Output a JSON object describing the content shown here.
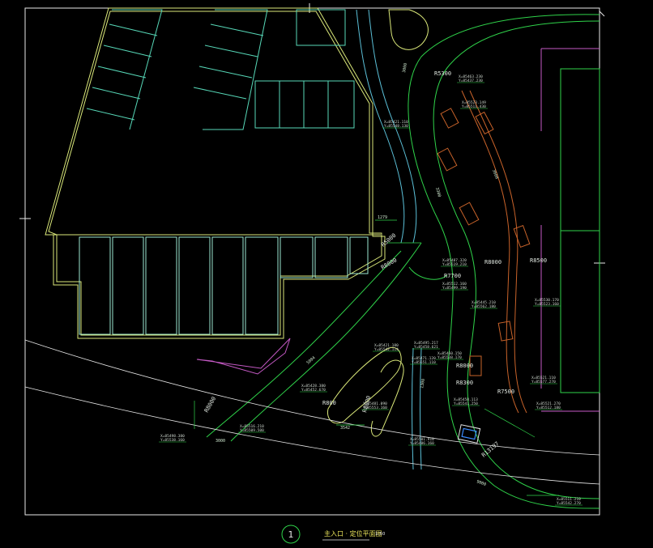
{
  "drawing": {
    "sheet_number": "1",
    "title": "主入口 · 定位平面图",
    "scale": "1:50"
  },
  "radius_labels": [
    "R5300",
    "R5000",
    "R8000",
    "R7700",
    "R8000",
    "R8500",
    "R8000",
    "R8300",
    "R7500",
    "R8000",
    "R800",
    "R8000",
    "R13197"
  ],
  "dimension_labels": [
    "3000",
    "1279",
    "3600",
    "5004",
    "3300",
    "3000",
    "3542",
    "1300",
    "9000"
  ],
  "coordinates": [
    {
      "x": "X=85463.230",
      "y": "Y=85437.230"
    },
    {
      "x": "X=85523.149",
      "y": "Y=85511.430"
    },
    {
      "x": "X=85421.110",
      "y": "Y=85548.130"
    },
    {
      "x": "X=85487.320",
      "y": "Y=85519.210"
    },
    {
      "x": "X=85512.160",
      "y": "Y=85499.190"
    },
    {
      "x": "X=85445.210",
      "y": "Y=85562.180"
    },
    {
      "x": "X=85495.217",
      "y": "Y=85458.621"
    },
    {
      "x": "X=85421.180",
      "y": "Y=85542.114"
    },
    {
      "x": "X=85460.150",
      "y": "Y=85538.170"
    },
    {
      "x": "X=85471.120",
      "y": "Y=85551.110"
    },
    {
      "x": "X=85521.110",
      "y": "Y=85577.270"
    },
    {
      "x": "X=85428.380",
      "y": "Y=85452.670"
    },
    {
      "x": "X=85481.090",
      "y": "Y=85553.160"
    },
    {
      "x": "X=85458.113",
      "y": "Y=85541.250"
    },
    {
      "x": "X=85521.270",
      "y": "Y=85512.180"
    },
    {
      "x": "X=85516.210",
      "y": "Y=85509.500"
    },
    {
      "x": "X=85498.380",
      "y": "Y=85538.160"
    },
    {
      "x": "X=85501.910",
      "y": "Y=85486.160"
    },
    {
      "x": "X=85511.210",
      "y": "Y=85542.270"
    },
    {
      "x": "X=85530.170",
      "y": "Y=85523.160"
    }
  ],
  "colors": {
    "background": "#000000",
    "frame": "#ffffff",
    "road": "#2fd34a",
    "building": "#dbe97a",
    "parking": "#57d8b8",
    "planting": "#5bc0d8",
    "boundary": "#c65ac6",
    "pavers": "#c9632a",
    "dimension": "#2fd34a",
    "text": "#e6e6e6"
  }
}
